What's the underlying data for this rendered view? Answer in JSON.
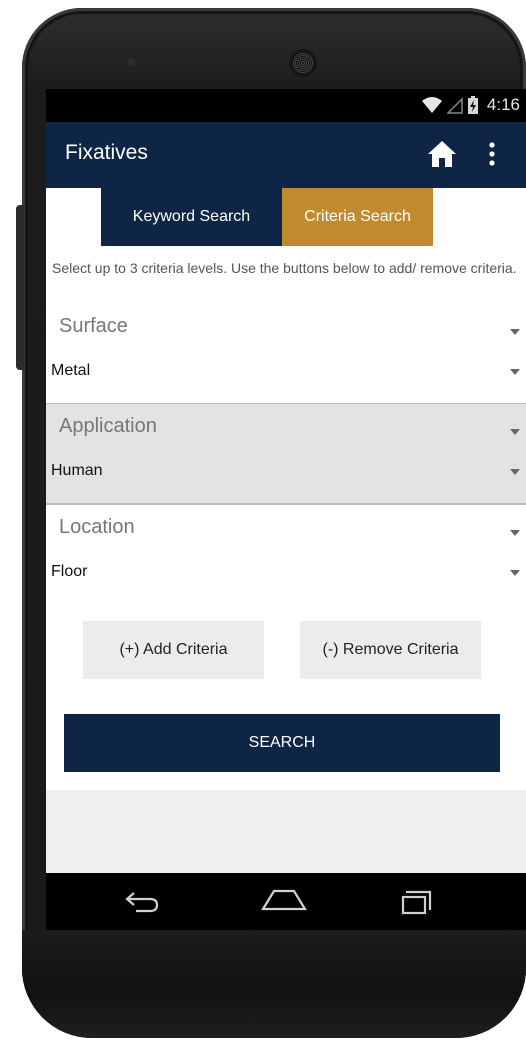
{
  "status_bar": {
    "time": "4:16",
    "icons": [
      "wifi-icon",
      "cell-signal-icon",
      "battery-charging-icon"
    ]
  },
  "app_bar": {
    "title": "Fixatives",
    "icons": [
      "home-icon",
      "overflow-menu-icon"
    ]
  },
  "tabs": [
    {
      "label": "Keyword Search",
      "selected": false
    },
    {
      "label": "Criteria Search",
      "selected": true
    }
  ],
  "instructions": "Select up to 3 criteria levels. Use the buttons below to add/ remove criteria.",
  "criteria": [
    {
      "label": "Surface",
      "value": "Metal"
    },
    {
      "label": "Application",
      "value": "Human"
    },
    {
      "label": "Location",
      "value": "Floor"
    }
  ],
  "buttons": {
    "add_label": "(+) Add Criteria",
    "remove_label": "(-) Remove Criteria",
    "search_label": "SEARCH"
  },
  "nav_bar": {
    "icons": [
      "back-icon",
      "home-nav-icon",
      "recent-apps-icon"
    ]
  },
  "colors": {
    "navy": "#0f2546",
    "gold": "#c08b2e",
    "band": "#e3e3e3"
  }
}
